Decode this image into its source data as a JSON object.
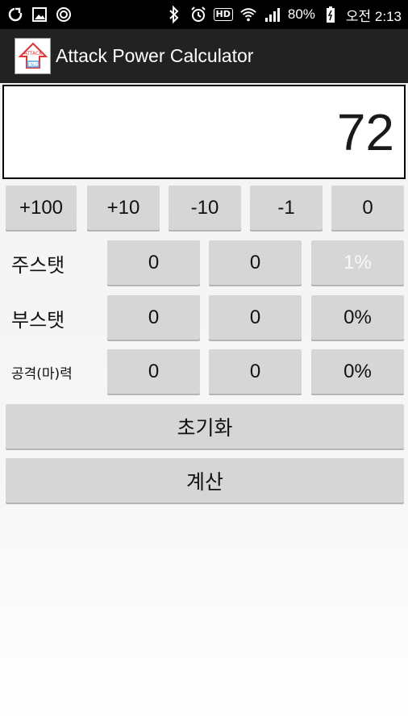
{
  "status_bar": {
    "battery": "80%",
    "time": "오전 2:13",
    "hd": "HD",
    "icons": [
      "sync-icon",
      "gallery-icon",
      "target-icon",
      "bluetooth-icon",
      "alarm-icon",
      "hd-icon",
      "wifi-icon",
      "signal-icon",
      "battery-icon"
    ]
  },
  "app": {
    "title": "Attack Power Calculator",
    "icon_text": "ATTACK CALC"
  },
  "display": {
    "value": "72"
  },
  "increment_buttons": [
    "+100",
    "+10",
    "-10",
    "-1",
    "0"
  ],
  "rows": [
    {
      "label": "주스탯",
      "values": [
        "0",
        "0"
      ],
      "percent": "1%"
    },
    {
      "label": "부스탯",
      "values": [
        "0",
        "0"
      ],
      "percent": "0%"
    },
    {
      "label": "공격(마)력",
      "values": [
        "0",
        "0"
      ],
      "percent": "0%"
    }
  ],
  "actions": {
    "reset": "초기화",
    "calculate": "계산"
  },
  "colors": {
    "button": "#d6d6d6",
    "actionbar": "#222222",
    "statusbar": "#000000"
  }
}
